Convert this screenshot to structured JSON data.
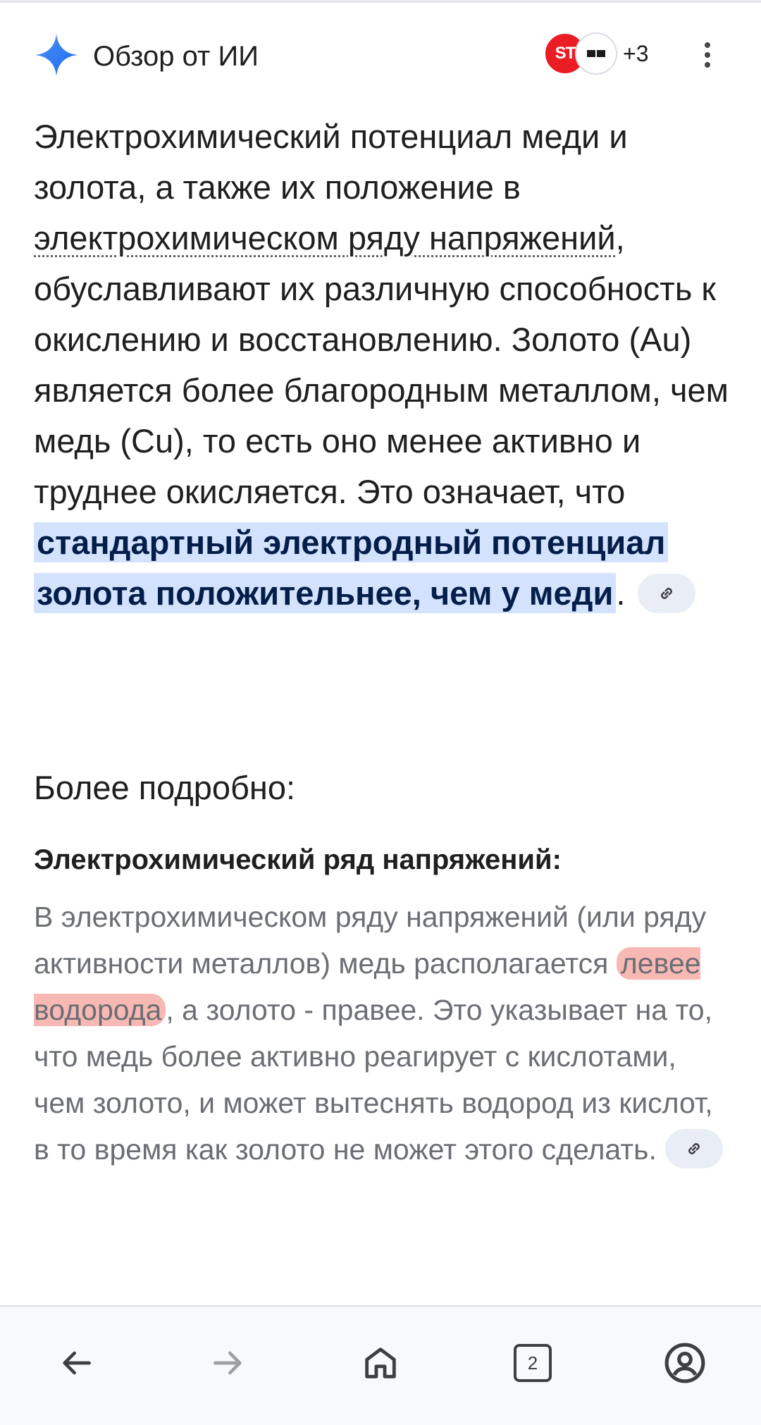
{
  "header": {
    "title": "Обзор от ИИ",
    "sources": {
      "first_icon_text": "ST",
      "more_count": "+3"
    },
    "more_icon": "more-vert-icon"
  },
  "main": {
    "part1": "Электрохимический потенциал меди и золота, а также их положение в ",
    "link_text": "электрохимическом ряду напряжений",
    "part2": ", обуславливают их различную способность к окислению и восстановлению. Золото (Au) является более благородным металлом, чем медь (Cu), то есть оно менее активно и труднее окисляется. Это означает, что ",
    "highlight": "стандартный электродный потенциал золота положительнее, чем у меди",
    "part3": "."
  },
  "section": {
    "title": "Более подробно:",
    "subtitle": "Электрохимический ряд напряжений:",
    "text1": "В электрохимическом ряду напряжений (или ряду активности металлов) медь располагается ",
    "highlight": "левее водорода",
    "text2": ", а золото - правее. Это указывает на то, что медь более активно реагирует с кислотами, чем золото, и может вытеснять водород из кислот, в то время как золото не может этого сделать."
  },
  "bottom_nav": {
    "tab_count": "2",
    "icons": [
      "back-arrow-icon",
      "forward-arrow-icon",
      "home-icon",
      "tabs-icon",
      "account-icon"
    ]
  },
  "colors": {
    "highlight_blue": "#d3e3fd",
    "highlight_red": "#f8b8b4",
    "spark_blue": "#3186ff"
  }
}
